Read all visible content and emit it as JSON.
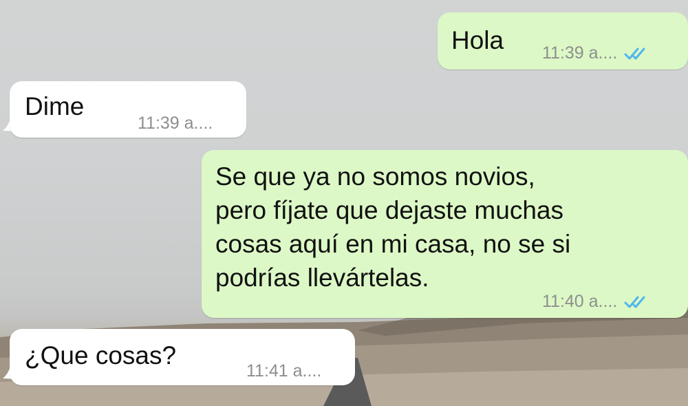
{
  "chat": {
    "messages": [
      {
        "direction": "outgoing",
        "text": "Hola",
        "time": "11:39 a....",
        "status": "read-double-check-icon"
      },
      {
        "direction": "incoming",
        "text": "Dime",
        "time": "11:39 a...."
      },
      {
        "direction": "outgoing",
        "text": "Se que ya no somos novios,\npero fíjate que dejaste muchas\ncosas aquí en mi casa, no se si\npodrías llevártelas.",
        "time": "11:40 a....",
        "status": "read-double-check-icon"
      },
      {
        "direction": "incoming",
        "text": "¿Que cosas?",
        "time": "11:41 a...."
      }
    ]
  },
  "colors": {
    "outgoing_bubble": "#dcf8c6",
    "incoming_bubble": "#ffffff",
    "read_ticks": "#4fb6ec",
    "timestamp": "#8e8e8e"
  }
}
